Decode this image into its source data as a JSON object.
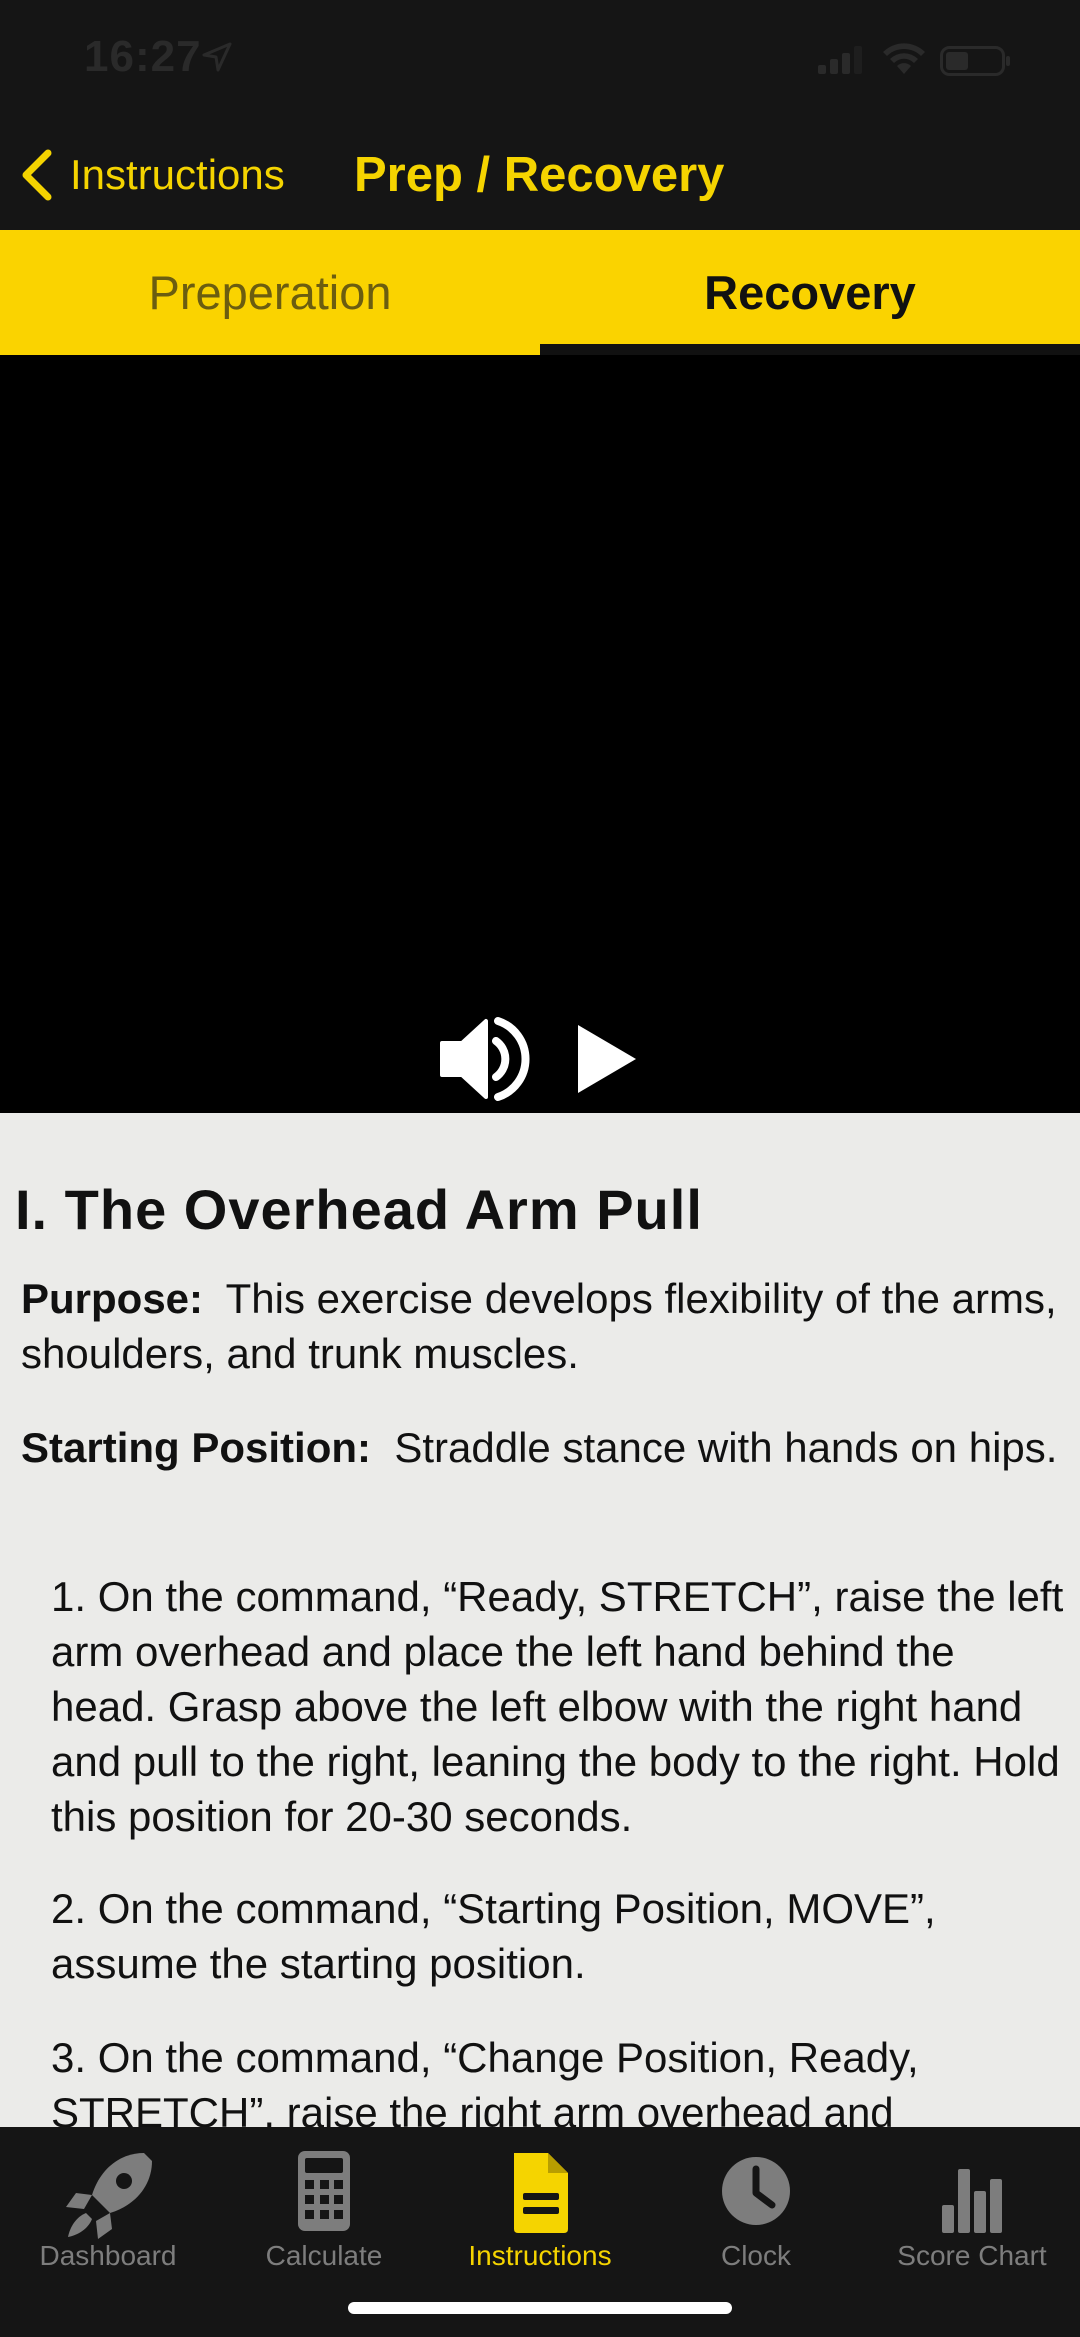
{
  "status": {
    "time": "16:27"
  },
  "nav": {
    "back_label": "Instructions",
    "title": "Prep / Recovery"
  },
  "tabs": [
    {
      "label": "Preperation",
      "selected": false
    },
    {
      "label": "Recovery",
      "selected": true
    }
  ],
  "content": {
    "title": "I. The Overhead Arm Pull",
    "purpose_label": "Purpose:",
    "purpose_text": "This exercise develops flexibility of the arms, shoulders, and trunk muscles.",
    "starting_label": "Starting Position:",
    "starting_text": "Straddle stance with hands on hips.",
    "steps": [
      "1. On the command, “Ready, STRETCH”, raise the left arm overhead and place the left hand behind the head. Grasp above the left elbow with the right hand and pull to the right, leaning the body to the right. Hold this position for 20-30 seconds.",
      "2. On the command, “Starting Position, MOVE”, assume the starting position.",
      "3. On the command, “Change Position, Ready, STRETCH”, raise the right arm overhead and"
    ]
  },
  "tabbar": {
    "items": [
      {
        "label": "Dashboard",
        "icon": "rocket-icon",
        "active": false
      },
      {
        "label": "Calculate",
        "icon": "calculator-icon",
        "active": false
      },
      {
        "label": "Instructions",
        "icon": "document-icon",
        "active": true
      },
      {
        "label": "Clock",
        "icon": "clock-icon",
        "active": false
      },
      {
        "label": "Score Chart",
        "icon": "bar-chart-icon",
        "active": false
      }
    ]
  },
  "colors": {
    "accent": "#f5d400",
    "tab_bar": "#fad300",
    "background": "#151515",
    "content_bg": "#ebebe9",
    "inactive": "#7d7d7d"
  }
}
